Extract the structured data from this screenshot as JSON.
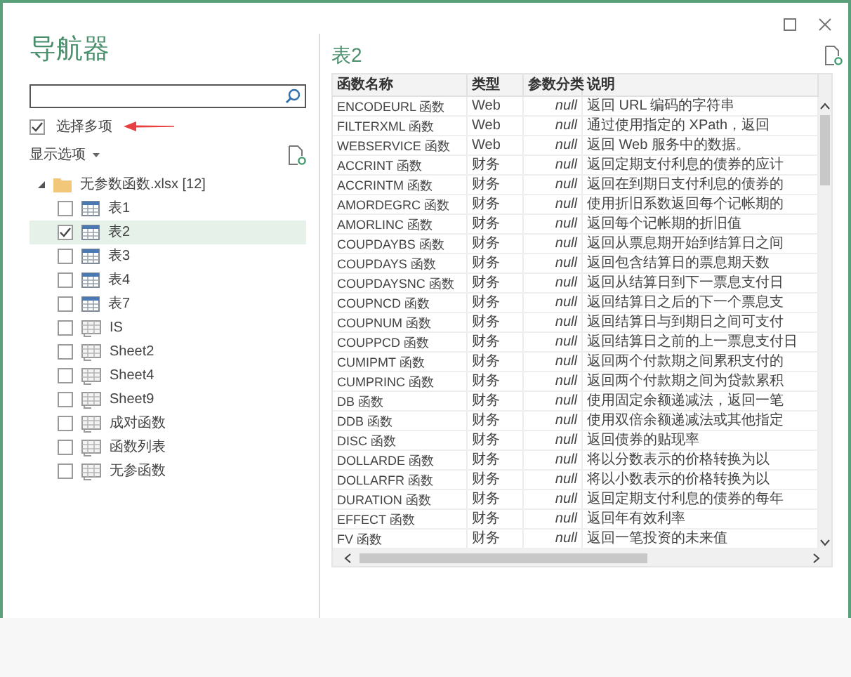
{
  "window": {
    "title": "导航器"
  },
  "multi_select": {
    "label": "选择多项",
    "checked": true
  },
  "display_options": {
    "label": "显示选项"
  },
  "tree": {
    "name": "无参数函数.xlsx [12]",
    "expanded": true,
    "children": [
      {
        "name": "表1",
        "kind": "table",
        "checked": false,
        "selected": false
      },
      {
        "name": "表2",
        "kind": "table",
        "checked": true,
        "selected": true
      },
      {
        "name": "表3",
        "kind": "table",
        "checked": false,
        "selected": false
      },
      {
        "name": "表4",
        "kind": "table",
        "checked": false,
        "selected": false
      },
      {
        "name": "表7",
        "kind": "table",
        "checked": false,
        "selected": false
      },
      {
        "name": "IS",
        "kind": "sheet",
        "checked": false,
        "selected": false
      },
      {
        "name": "Sheet2",
        "kind": "sheet",
        "checked": false,
        "selected": false
      },
      {
        "name": "Sheet4",
        "kind": "sheet",
        "checked": false,
        "selected": false
      },
      {
        "name": "Sheet9",
        "kind": "sheet",
        "checked": false,
        "selected": false
      },
      {
        "name": "成对函数",
        "kind": "sheet",
        "checked": false,
        "selected": false
      },
      {
        "name": "函数列表",
        "kind": "sheet",
        "checked": false,
        "selected": false
      },
      {
        "name": "无参函数",
        "kind": "sheet",
        "checked": false,
        "selected": false
      }
    ]
  },
  "preview": {
    "title": "表2",
    "table": {
      "columns": [
        "函数名称",
        "类型",
        "参数分类",
        "说明"
      ],
      "rows": [
        [
          "ENCODEURL 函数",
          "Web",
          "null",
          "返回 URL 编码的字符串"
        ],
        [
          "FILTERXML 函数",
          "Web",
          "null",
          "通过使用指定的 XPath，返回"
        ],
        [
          "WEBSERVICE 函数",
          "Web",
          "null",
          "返回 Web 服务中的数据。"
        ],
        [
          "ACCRINT 函数",
          "财务",
          "null",
          "返回定期支付利息的债券的应计"
        ],
        [
          "ACCRINTM 函数",
          "财务",
          "null",
          "返回在到期日支付利息的债券的"
        ],
        [
          "AMORDEGRC 函数",
          "财务",
          "null",
          "使用折旧系数返回每个记帐期的"
        ],
        [
          "AMORLINC 函数",
          "财务",
          "null",
          "返回每个记帐期的折旧值"
        ],
        [
          "COUPDAYBS 函数",
          "财务",
          "null",
          "返回从票息期开始到结算日之间"
        ],
        [
          "COUPDAYS 函数",
          "财务",
          "null",
          "返回包含结算日的票息期天数"
        ],
        [
          "COUPDAYSNC 函数",
          "财务",
          "null",
          "返回从结算日到下一票息支付日"
        ],
        [
          "COUPNCD 函数",
          "财务",
          "null",
          "返回结算日之后的下一个票息支"
        ],
        [
          "COUPNUM 函数",
          "财务",
          "null",
          "返回结算日与到期日之间可支付"
        ],
        [
          "COUPPCD 函数",
          "财务",
          "null",
          "返回结算日之前的上一票息支付日"
        ],
        [
          "CUMIPMT 函数",
          "财务",
          "null",
          "返回两个付款期之间累积支付的"
        ],
        [
          "CUMPRINC 函数",
          "财务",
          "null",
          "返回两个付款期之间为贷款累积"
        ],
        [
          "DB 函数",
          "财务",
          "null",
          "使用固定余额递减法，返回一笔"
        ],
        [
          "DDB 函数",
          "财务",
          "null",
          "使用双倍余额递减法或其他指定"
        ],
        [
          "DISC 函数",
          "财务",
          "null",
          "返回债券的贴现率"
        ],
        [
          "DOLLARDE 函数",
          "财务",
          "null",
          "将以分数表示的价格转换为以"
        ],
        [
          "DOLLARFR 函数",
          "财务",
          "null",
          "将以小数表示的价格转换为以"
        ],
        [
          "DURATION 函数",
          "财务",
          "null",
          "返回定期支付利息的债券的每年"
        ],
        [
          "EFFECT 函数",
          "财务",
          "null",
          "返回年有效利率"
        ],
        [
          "FV 函数",
          "财务",
          "null",
          "返回一笔投资的未来值"
        ]
      ]
    }
  }
}
